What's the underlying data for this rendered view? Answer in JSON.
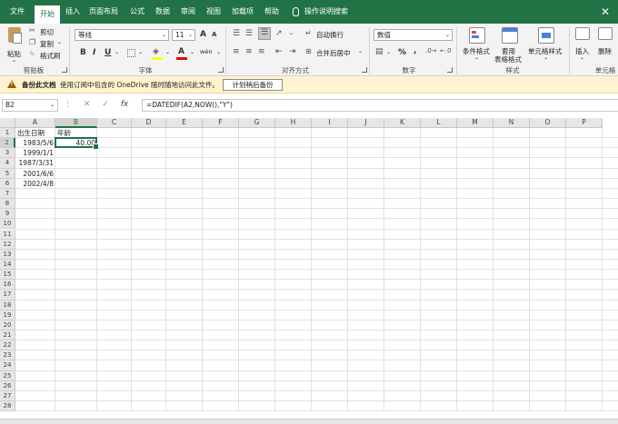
{
  "tabs": {
    "items": [
      "文件",
      "开始",
      "插入",
      "页面布局",
      "公式",
      "数据",
      "审阅",
      "视图",
      "加载项",
      "帮助"
    ],
    "active": 1,
    "search": "操作说明搜索"
  },
  "ribbon": {
    "clipboard": {
      "paste": "粘贴",
      "cut": "剪切",
      "copy": "复制",
      "format_painter": "格式刷",
      "label": "剪贴板"
    },
    "font": {
      "name": "等线",
      "size": "11",
      "bold": "B",
      "italic": "I",
      "underline": "U",
      "grow": "A",
      "shrink": "A",
      "font_color": "A",
      "phonetic": "wén",
      "label": "字体"
    },
    "alignment": {
      "wrap": "自动换行",
      "merge": "合并后居中",
      "label": "对齐方式"
    },
    "number": {
      "format": "数值",
      "percent": "%",
      "comma": ",",
      "label": "数字"
    },
    "styles": {
      "conditional": "条件格式",
      "table_1": "套用",
      "table_2": "表格格式",
      "cell_styles": "单元格样式",
      "label": "样式"
    },
    "cells": {
      "insert": "插入",
      "delete": "删除",
      "label": "单元格"
    }
  },
  "notice": {
    "title": "备份此文档",
    "message": "使用订阅中包含的 OneDrive 随时随地访问此文件。",
    "button": "计划稍后备份"
  },
  "formula_bar": {
    "name_box": "B2",
    "formula": "=DATEDIF(A2,NOW(),\"Y\")"
  },
  "sheet": {
    "columns": [
      "A",
      "B",
      "C",
      "D",
      "E",
      "F",
      "G",
      "H",
      "I",
      "J",
      "K",
      "L",
      "M",
      "N",
      "O",
      "P"
    ],
    "selected_col": "B",
    "selected_row": 2,
    "row_count": 28,
    "cells": {
      "A1": "出生日期",
      "B1": "年龄",
      "A2": "1983/5/6",
      "B2": "40.00",
      "A3": "1999/1/1",
      "A4": "1987/3/31",
      "A5": "2001/6/6",
      "A6": "2002/4/8"
    }
  },
  "colors": {
    "brand": "#217346",
    "notice_bg": "#fff4ce"
  }
}
